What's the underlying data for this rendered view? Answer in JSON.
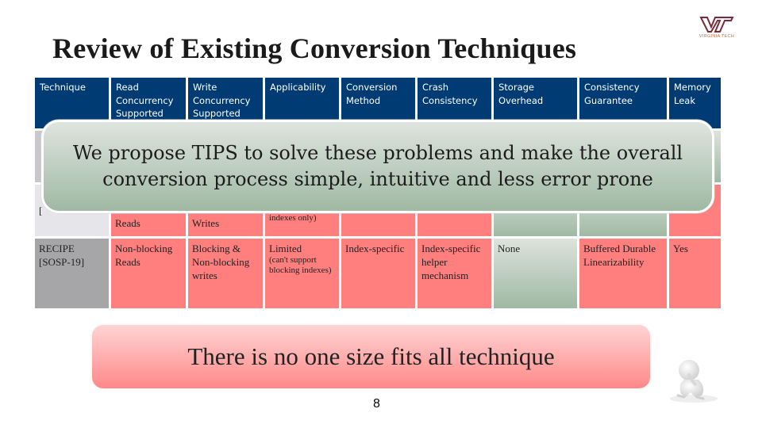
{
  "slide": {
    "title": "Review of Existing Conversion Techniques",
    "logo_text": "VIRGINIA TECH",
    "page_number": "8"
  },
  "table": {
    "headers": [
      "Technique",
      "Read Concurrency Supported",
      "Write Concurrency Supported",
      "Applicability",
      "Conversion Method",
      "Crash Consistency",
      "Storage Overhead",
      "Consistency Guarantee",
      "Memory Leak"
    ],
    "rows": [
      {
        "cells": [
          "",
          "",
          "",
          "",
          "",
          "",
          "",
          "",
          ""
        ],
        "status": [
          "neutral",
          "hidden",
          "hidden",
          "hidden",
          "hidden",
          "hidden",
          "hidden",
          "hidden",
          "good"
        ]
      },
      {
        "cells": [
          "[",
          "Reads",
          "Writes",
          "indexes only)",
          "",
          "",
          "",
          "",
          ""
        ],
        "status": [
          "neutral",
          "bad",
          "bad",
          "bad",
          "bad",
          "bad",
          "good",
          "good",
          "bad"
        ]
      },
      {
        "cells": [
          "RECIPE [SOSP-19]",
          "Non-blocking Reads",
          "Blocking & Non-blocking writes",
          "Limited",
          "Index-specific",
          "Index-specific helper mechanism",
          "None",
          "Buffered Durable Linearizability",
          "Yes"
        ],
        "applicability_note": "(can't support blocking indexes)",
        "status": [
          "neutral",
          "bad",
          "bad",
          "bad",
          "bad",
          "bad",
          "good",
          "bad",
          "bad"
        ]
      }
    ]
  },
  "overlay": {
    "line1": "We propose TIPS to solve these problems and make the overall",
    "line2": "conversion process simple, intuitive and less error prone"
  },
  "banner": {
    "text": "There is no one size fits all technique"
  },
  "colors": {
    "header_bg": "#003b73",
    "bad": "#ff7f7f",
    "good_top": "#dde3dd",
    "good_bottom": "#9fb9a3",
    "banner_top": "#ffd4d4",
    "banner_bottom": "#ff8888"
  },
  "icons": {
    "logo": "virginia-tech-logo",
    "figure": "thinking-person-figure"
  }
}
